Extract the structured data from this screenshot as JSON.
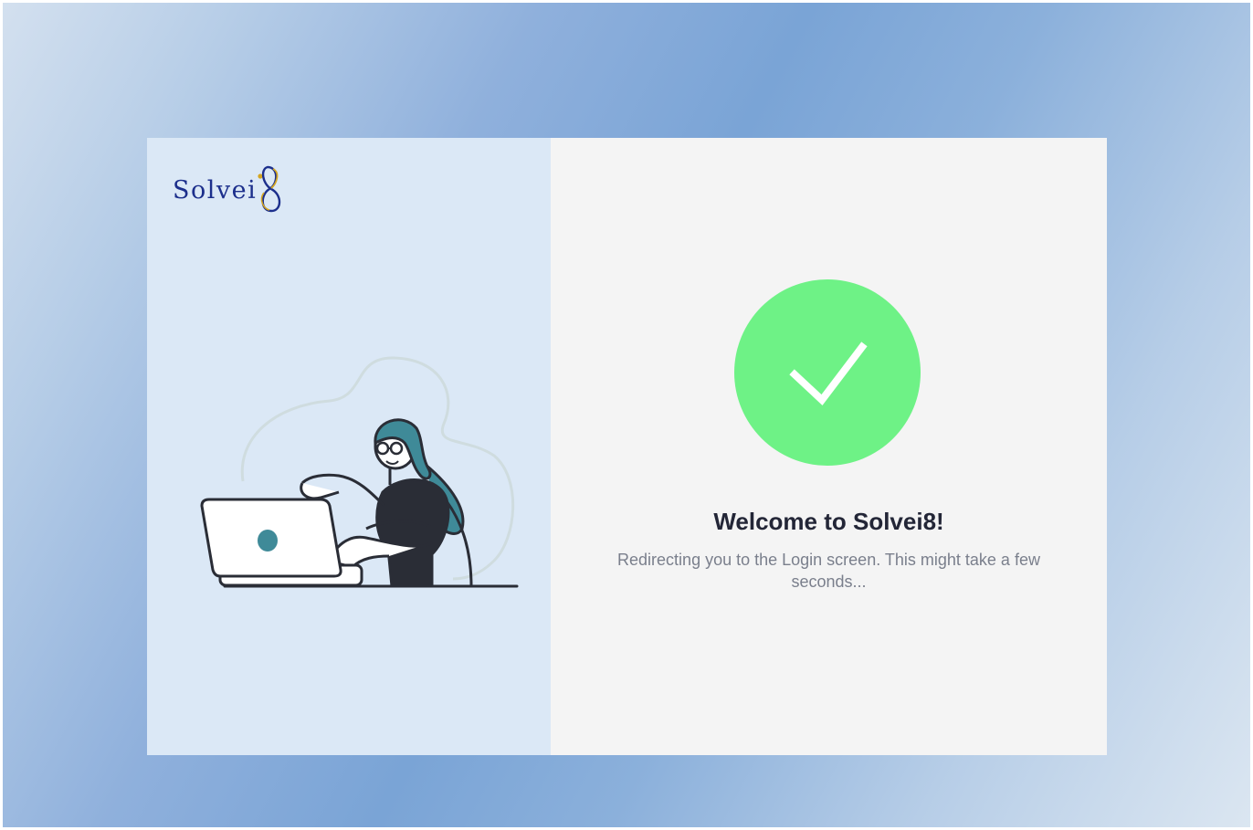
{
  "brand": {
    "name": "Solvei8",
    "logo_text": "Solvei",
    "logo_mark": "8"
  },
  "illustration": {
    "name": "person-at-laptop-illustration"
  },
  "status": {
    "icon": "checkmark-icon",
    "color": "#6ef286",
    "title": "Welcome to Solvei8!",
    "message": "Redirecting you to the Login screen. This might take a few seconds..."
  },
  "colors": {
    "left_panel": "#dbe8f6",
    "right_panel": "#f4f4f4",
    "brand_blue": "#1c2f8c",
    "brand_gold": "#d4a520",
    "illustration_teal": "#3f8a98"
  }
}
